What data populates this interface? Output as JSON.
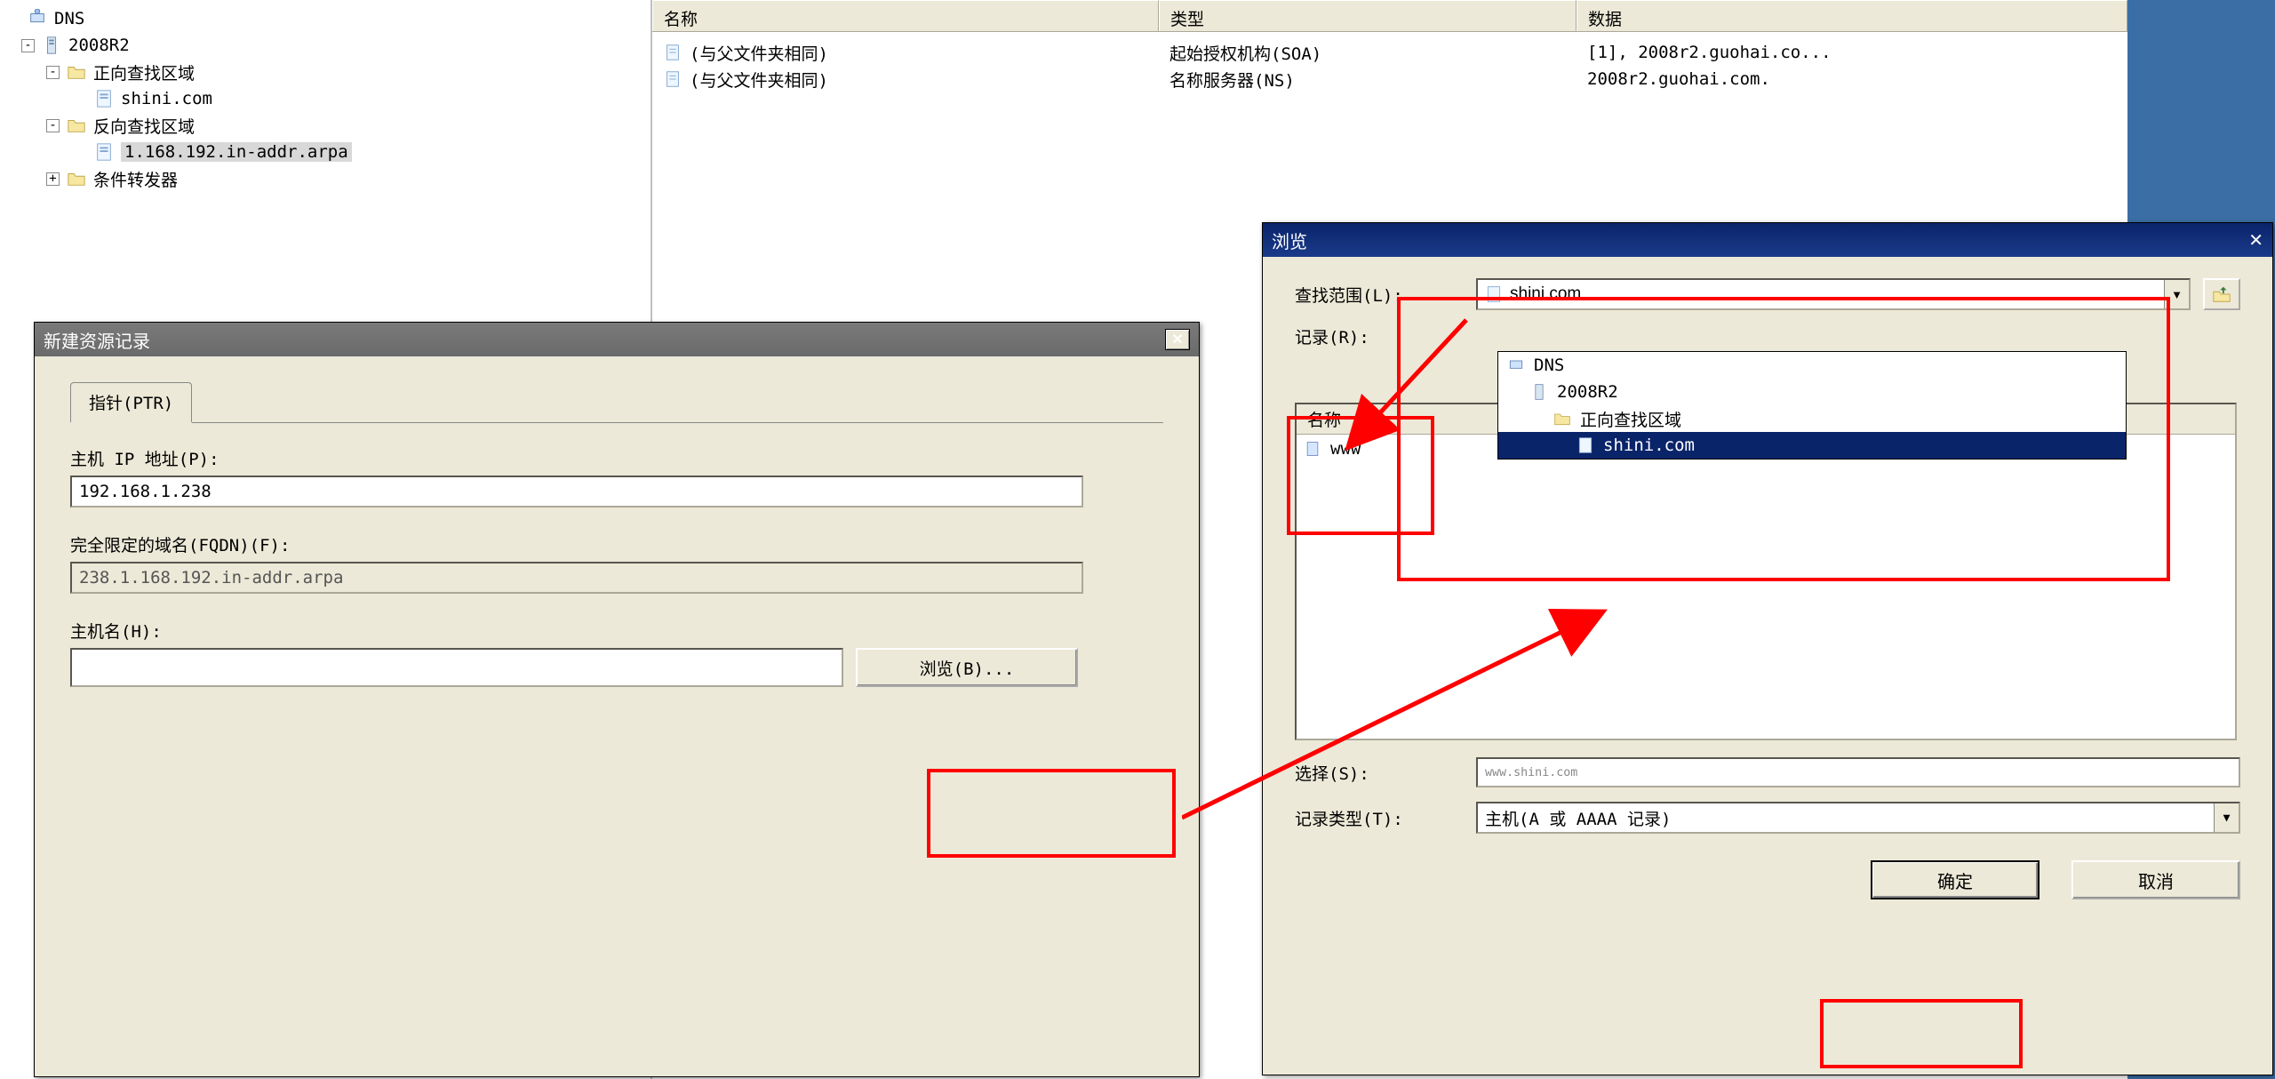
{
  "tree": {
    "root": "DNS",
    "server": "2008R2",
    "fwd_zone": "正向查找区域",
    "fwd_zone_item": "shini.com",
    "rev_zone": "反向查找区域",
    "rev_zone_item": "1.168.192.in-addr.arpa",
    "cond_fwd": "条件转发器"
  },
  "list": {
    "headers": {
      "name": "名称",
      "type": "类型",
      "data": "数据"
    },
    "rows": [
      {
        "name": "(与父文件夹相同)",
        "type": "起始授权机构(SOA)",
        "data": "[1], 2008r2.guohai.co..."
      },
      {
        "name": "(与父文件夹相同)",
        "type": "名称服务器(NS)",
        "data": "2008r2.guohai.com."
      }
    ]
  },
  "new_dlg": {
    "title": "新建资源记录",
    "tab": "指针(PTR)",
    "ip_label": "主机 IP 地址(P):",
    "ip_value": "192.168.1.238",
    "fqdn_label": "完全限定的域名(FQDN)(F):",
    "fqdn_value": "238.1.168.192.in-addr.arpa",
    "host_label": "主机名(H):",
    "host_value": "",
    "browse_btn": "浏览(B)..."
  },
  "browse_dlg": {
    "title": "浏览",
    "scope_label": "查找范围(L):",
    "scope_value": "shini.com",
    "records_label": "记录(R):",
    "name_col": "名称",
    "record_www": "www",
    "dropdown": {
      "dns": "DNS",
      "server": "2008R2",
      "fwd_zone": "正向查找区域",
      "selected": "shini.com"
    },
    "select_label": "选择(S):",
    "select_value": "www.shini.com",
    "type_label": "记录类型(T):",
    "type_value": "主机(A 或 AAAA 记录)",
    "ok": "确定",
    "cancel": "取消"
  }
}
